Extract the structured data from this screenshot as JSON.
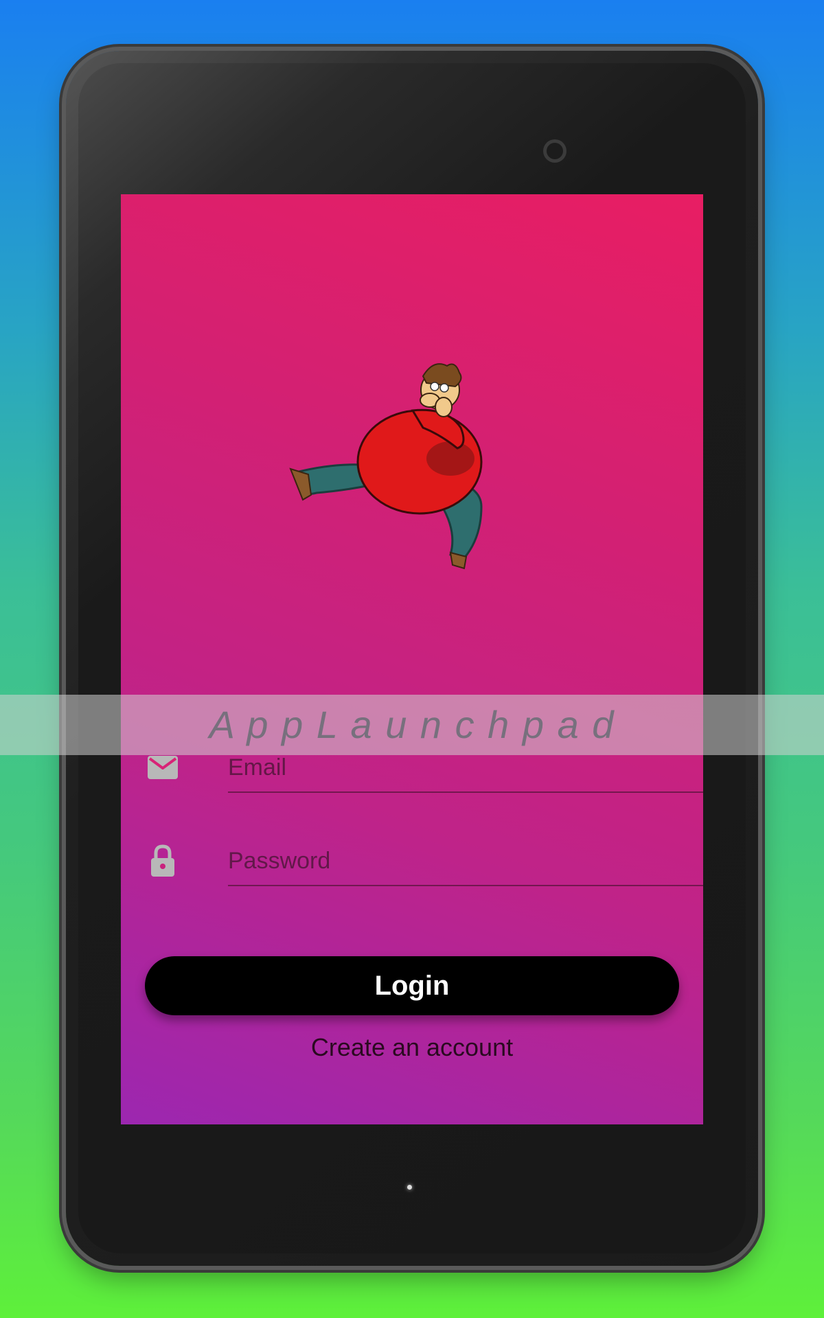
{
  "app": {
    "title": "A p p L a u n c h p a d"
  },
  "login_form": {
    "email_placeholder": "Email",
    "password_placeholder": "Password",
    "login_label": "Login",
    "create_account_label": "Create an account"
  },
  "icons": {
    "email": "envelope-icon",
    "password": "lock-icon",
    "logo": "cartoon-character-logo"
  },
  "colors": {
    "screen_gradient_top": "#e81e63",
    "screen_gradient_bottom": "#9c27b0",
    "button_bg": "#000000",
    "button_text": "#ffffff"
  }
}
